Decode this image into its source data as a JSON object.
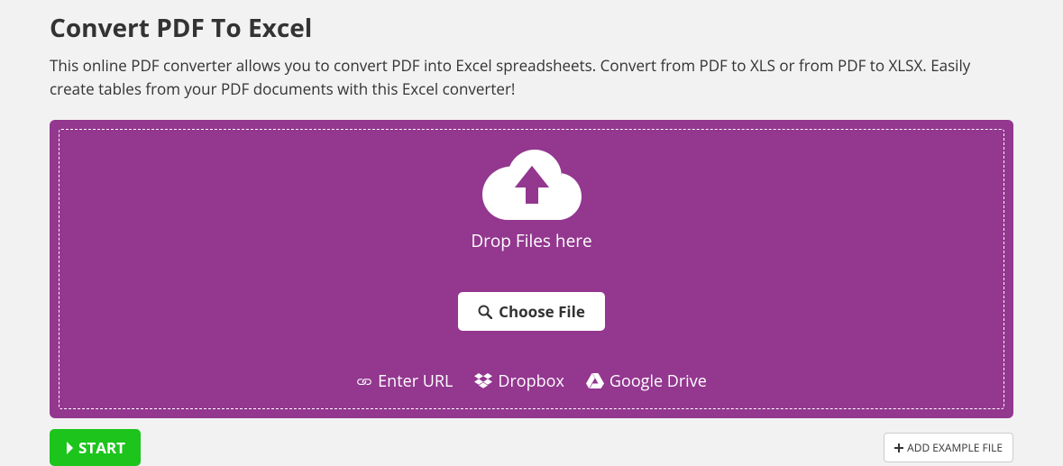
{
  "title": "Convert PDF To Excel",
  "description": "This online PDF converter allows you to convert PDF into Excel spreadsheets. Convert from PDF to XLS or from PDF to XLSX. Easily create tables from your PDF documents with this Excel converter!",
  "upload": {
    "drop_text": "Drop Files here",
    "choose_file_label": "Choose File",
    "sources": {
      "url": "Enter URL",
      "dropbox": "Dropbox",
      "gdrive": "Google Drive"
    }
  },
  "actions": {
    "start_label": "START",
    "add_example_label": "ADD EXAMPLE FILE"
  },
  "colors": {
    "accent": "#93378f",
    "start_green": "#1cc41c"
  }
}
